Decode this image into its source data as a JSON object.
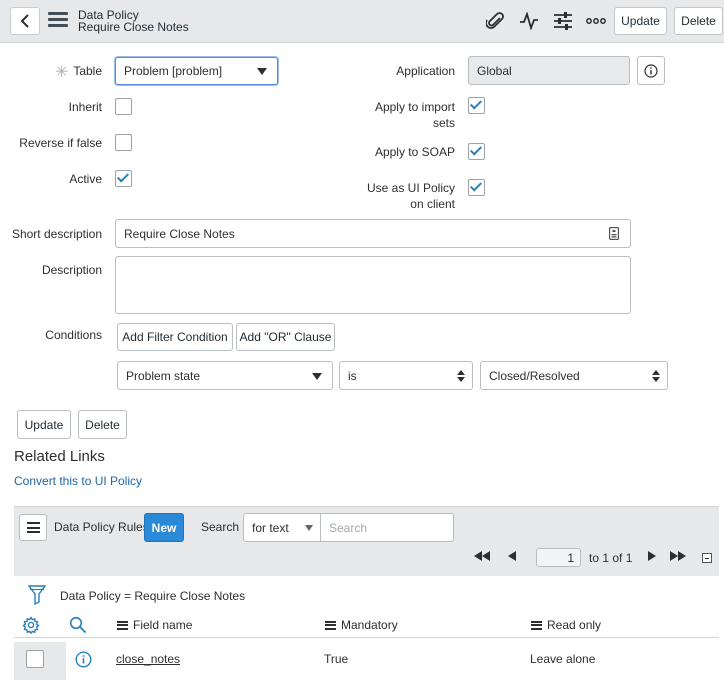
{
  "header": {
    "breadcrumb": "Data Policy",
    "title": "Require Close Notes",
    "update_label": "Update",
    "delete_label": "Delete"
  },
  "form": {
    "table": {
      "label": "Table",
      "value": "Problem [problem]"
    },
    "application": {
      "label": "Application",
      "value": "Global"
    },
    "inherit": {
      "label": "Inherit",
      "checked": false
    },
    "apply_import": {
      "label_line1": "Apply to import",
      "label_line2": "sets",
      "checked": true
    },
    "reverse": {
      "label": "Reverse if false",
      "checked": false
    },
    "apply_soap": {
      "label": "Apply to SOAP",
      "checked": true
    },
    "active": {
      "label": "Active",
      "checked": true
    },
    "ui_policy": {
      "label_line1": "Use as UI Policy",
      "label_line2": "on client",
      "checked": true
    },
    "short_description": {
      "label": "Short description",
      "value": "Require Close Notes"
    },
    "description": {
      "label": "Description",
      "value": ""
    },
    "conditions": {
      "label": "Conditions",
      "add_filter_label": "Add Filter Condition",
      "add_or_label": "Add \"OR\" Clause",
      "field": "Problem state",
      "operator": "is",
      "value": "Closed/Resolved"
    },
    "update_label": "Update",
    "delete_label": "Delete"
  },
  "related_links": {
    "title": "Related Links",
    "convert_link": "Convert this to UI Policy"
  },
  "list": {
    "title": "Data Policy Rules",
    "new_label": "New",
    "search_label": "Search",
    "search_field": "for text",
    "search_placeholder": "Search",
    "page_value": "1",
    "page_info": "to 1 of 1",
    "filter_text": "Data Policy = Require Close Notes",
    "columns": [
      "Field name",
      "Mandatory",
      "Read only"
    ],
    "rows": [
      {
        "field_name": "close_notes",
        "mandatory": "True",
        "read_only": "Leave alone"
      }
    ]
  },
  "colors": {
    "accent": "#2b8ad8",
    "check": "#2b7fb8",
    "header_bg": "#e6e8ea"
  }
}
